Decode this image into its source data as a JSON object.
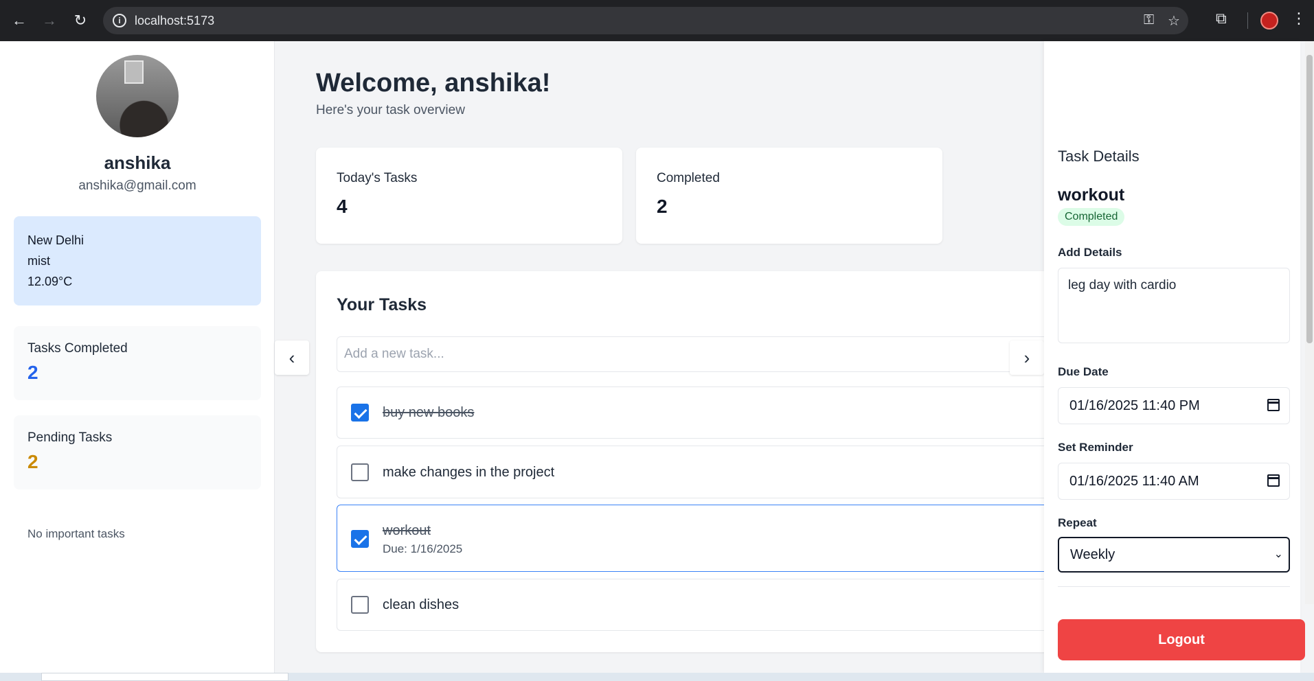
{
  "browser": {
    "url": "localhost:5173"
  },
  "sidebar": {
    "name": "anshika",
    "email": "anshika@gmail.com",
    "weather": {
      "city": "New Delhi",
      "condition": "mist",
      "temperature": "12.09°C"
    },
    "tasks_completed": {
      "label": "Tasks Completed",
      "value": "2",
      "color": "#2563eb"
    },
    "pending_tasks": {
      "label": "Pending Tasks",
      "value": "2",
      "color": "#ca8a04"
    },
    "important_text": "No important tasks"
  },
  "main": {
    "title": "Welcome, anshika!",
    "subtitle": "Here's your task overview",
    "stats": [
      {
        "label": "Today's Tasks",
        "value": "4"
      },
      {
        "label": "Completed",
        "value": "2"
      }
    ],
    "tasks_title": "Your Tasks",
    "new_task_placeholder": "Add a new task...",
    "tasks": [
      {
        "name": "buy new books",
        "completed": true,
        "due": ""
      },
      {
        "name": "make changes in the project",
        "completed": false,
        "due": ""
      },
      {
        "name": "workout",
        "completed": true,
        "due": "Due: 1/16/2025"
      },
      {
        "name": "clean dishes",
        "completed": false,
        "due": ""
      }
    ],
    "prev_icon": "chevron-left-icon",
    "next_icon": "chevron-right-icon"
  },
  "detail": {
    "heading": "Task Details",
    "task_name": "workout",
    "status": "Completed",
    "details_label": "Add Details",
    "details_value": "leg day with cardio",
    "due_label": "Due Date",
    "due_value": "01/16/2025 11:40 PM",
    "reminder_label": "Set Reminder",
    "reminder_value": "01/16/2025 11:40 AM",
    "repeat_label": "Repeat",
    "repeat_value": "Weekly",
    "logout_label": "Logout"
  }
}
